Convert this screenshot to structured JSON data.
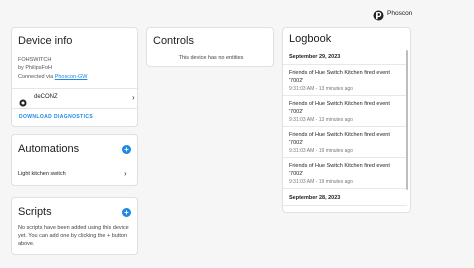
{
  "header": {
    "brand": "Phoscon",
    "accent": "#1e88e5"
  },
  "device_info": {
    "title": "Device info",
    "model": "FOHSWITCH",
    "manufacturer": "by PhilipsFoH",
    "connected_prefix": "Connected via",
    "connected_link": "Phoscon-GW",
    "integration": "deCONZ",
    "download_button": "DOWNLOAD DIAGNOSTICS"
  },
  "controls": {
    "title": "Controls",
    "empty_message": "This device has no entities"
  },
  "automations": {
    "title": "Automations",
    "items": [
      "Light kitchen switch"
    ]
  },
  "scripts": {
    "title": "Scripts",
    "empty_message": "No scripts have been added using this device yet. You can add one by clicking the + button above."
  },
  "logbook": {
    "title": "Logbook",
    "date1": "September 29, 2023",
    "entries": [
      {
        "text": "Friends of Hue Switch Kitchen fired event '7002'",
        "time": "9:31:03 AM - 13 minutes ago"
      },
      {
        "text": "Friends of Hue Switch Kitchen fired event '7002'",
        "time": "9:31:03 AM - 13 minutes ago"
      },
      {
        "text": "Friends of Hue Switch Kitchen fired event '7002'",
        "time": "9:31:03 AM - 19 minutes ago"
      },
      {
        "text": "Friends of Hue Switch Kitchen fired event '7002'",
        "time": "9:31:03 AM - 19 minutes ago"
      }
    ],
    "date2": "September 28, 2023"
  }
}
